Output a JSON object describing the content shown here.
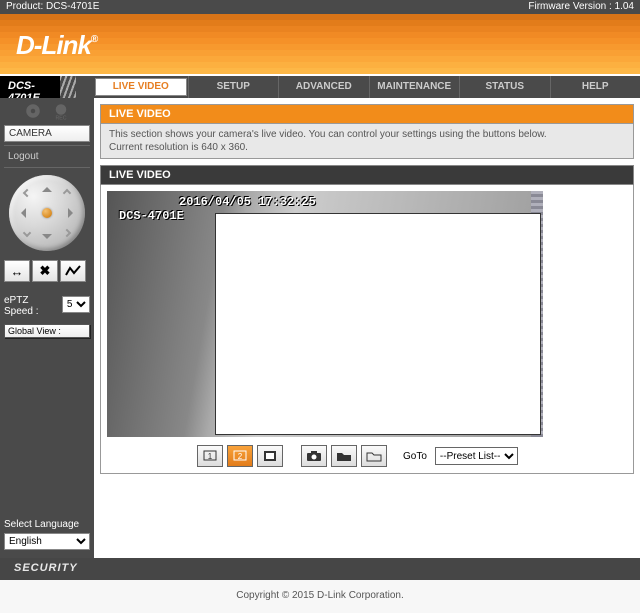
{
  "topbar": {
    "product_label": "Product: DCS-4701E",
    "firmware_label": "Firmware Version : 1.04"
  },
  "brand": "D-Link",
  "model": "DCS-4701E",
  "nav": {
    "live_video": "LIVE VIDEO",
    "setup": "SETUP",
    "advanced": "ADVANCED",
    "maintenance": "MAINTENANCE",
    "status": "STATUS",
    "help": "HELP"
  },
  "sidebar": {
    "camera": "CAMERA",
    "logout": "Logout",
    "eptz_label": "ePTZ Speed :",
    "eptz_value": "5",
    "global_view": "Global View :",
    "lang_label": "Select Language",
    "lang_value": "English"
  },
  "panel": {
    "title": "LIVE VIDEO",
    "note_line1": "This section shows your camera's live video. You can control your settings using the buttons below.",
    "note_line2": "Current resolution is 640 x 360.",
    "section": "LIVE VIDEO"
  },
  "video": {
    "timestamp": "2016/04/05 17:32:25",
    "camera_name": "DCS-4701E"
  },
  "controls": {
    "goto_label": "GoTo",
    "preset_value": "--Preset List--"
  },
  "footer": {
    "security": "SECURITY",
    "copyright": "Copyright © 2015 D-Link Corporation."
  }
}
